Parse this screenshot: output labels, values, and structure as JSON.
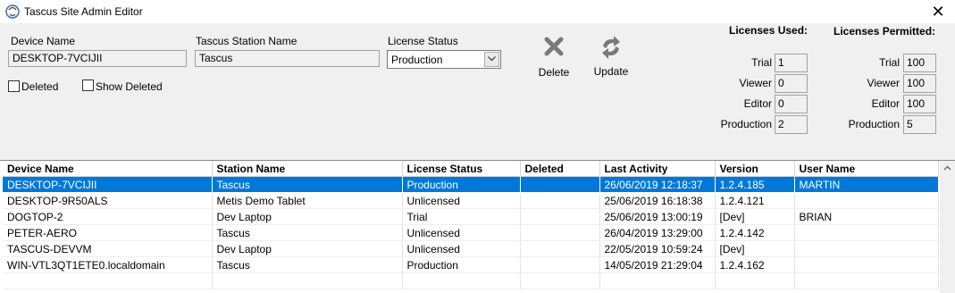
{
  "window": {
    "title": "Tascus Site Admin Editor"
  },
  "form": {
    "device_name_label": "Device Name",
    "device_name_value": "DESKTOP-7VCIJII",
    "station_name_label": "Tascus Station Name",
    "station_name_value": "Tascus",
    "license_status_label": "License Status",
    "license_status_value": "Production",
    "deleted_label": "Deleted",
    "show_deleted_label": "Show Deleted"
  },
  "toolbar": {
    "delete_label": "Delete",
    "update_label": "Update"
  },
  "licenses_used": {
    "header": "Licenses Used:",
    "rows": [
      {
        "label": "Trial",
        "value": "1"
      },
      {
        "label": "Viewer",
        "value": "0"
      },
      {
        "label": "Editor",
        "value": "0"
      },
      {
        "label": "Production",
        "value": "2"
      }
    ]
  },
  "licenses_permitted": {
    "header": "Licenses Permitted:",
    "rows": [
      {
        "label": "Trial",
        "value": "100"
      },
      {
        "label": "Viewer",
        "value": "100"
      },
      {
        "label": "Editor",
        "value": "100"
      },
      {
        "label": "Production",
        "value": "5"
      }
    ]
  },
  "grid": {
    "columns": [
      "Device Name",
      "Station Name",
      "License Status",
      "Deleted",
      "Last Activity",
      "Version",
      "User Name"
    ],
    "rows": [
      [
        "DESKTOP-7VCIJII",
        "Tascus",
        "Production",
        "",
        "26/06/2019 12:18:37",
        "1.2.4.185",
        "MARTIN"
      ],
      [
        "DESKTOP-9R50ALS",
        "Metis Demo Tablet",
        "Unlicensed",
        "",
        "25/06/2019 16:18:38",
        "1.2.4.121",
        ""
      ],
      [
        "DOGTOP-2",
        "Dev Laptop",
        "Trial",
        "",
        "25/06/2019 13:00:19",
        "[Dev]",
        "BRIAN"
      ],
      [
        "PETER-AERO",
        "Tascus",
        "Unlicensed",
        "",
        "26/04/2019 13:29:00",
        "1.2.4.142",
        ""
      ],
      [
        "TASCUS-DEVVM",
        "Dev Laptop",
        "Unlicensed",
        "",
        "22/05/2019 10:59:24",
        "[Dev]",
        ""
      ],
      [
        "WIN-VTL3QT1ETE0.localdomain",
        "Tascus",
        "Production",
        "",
        "14/05/2019 21:29:04",
        "1.2.4.162",
        ""
      ]
    ],
    "selected_index": 0
  },
  "colors": {
    "selection": "#0078d7",
    "panel": "#f0f0f0"
  }
}
